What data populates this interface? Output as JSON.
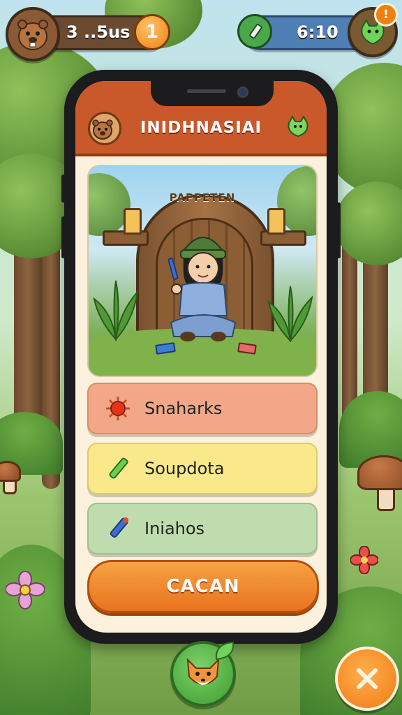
{
  "hud": {
    "player_value": "3 ..5us",
    "coin_count": "1",
    "timer": "6:10",
    "notification_count": "!"
  },
  "app": {
    "title": "INIDHNASIAI",
    "scene_title": "PAPPETEN"
  },
  "options": [
    {
      "label": "Snaharks",
      "icon": "sun-icon",
      "color": "#f2a789",
      "border": "#d98a6a"
    },
    {
      "label": "Soupdota",
      "icon": "pencil-icon",
      "color": "#f9e98a",
      "border": "#dccb66"
    },
    {
      "label": "Iniahos",
      "icon": "crayon-icon",
      "color": "#bfdcaf",
      "border": "#9fc08c"
    }
  ],
  "cancel_button": {
    "label": "CACAN"
  },
  "colors": {
    "header": "#c9582a",
    "cancel": "#e9731e",
    "timer_pill": "#4e7fb5"
  }
}
